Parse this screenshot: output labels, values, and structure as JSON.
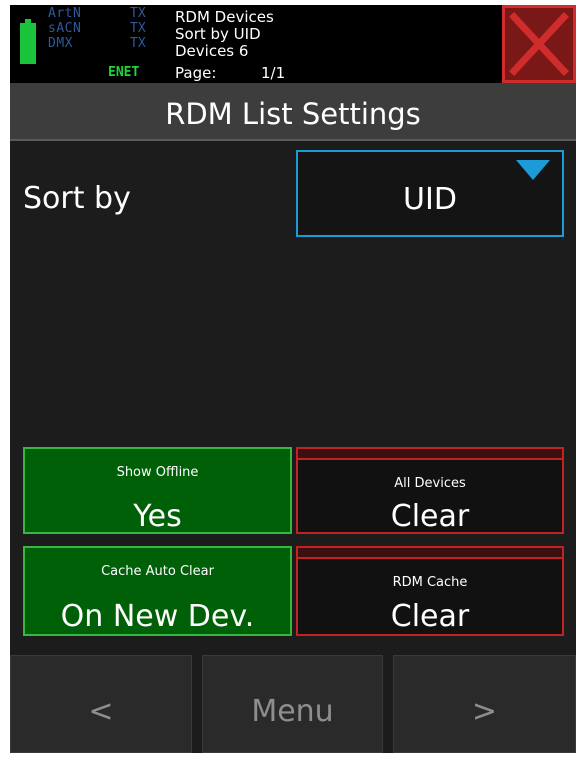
{
  "status": {
    "protocols": [
      {
        "name": "ArtN",
        "state": "TX"
      },
      {
        "name": "sACN",
        "state": "TX"
      },
      {
        "name": "DMX",
        "state": "TX"
      }
    ],
    "connection": "ENET",
    "info_title": "RDM Devices",
    "info_sort": "Sort by UID",
    "info_devices": "Devices 6",
    "page_label": "Page:",
    "page_value": "1/1"
  },
  "title": "RDM List Settings",
  "sort": {
    "label": "Sort by",
    "value": "UID"
  },
  "options": {
    "show_offline": {
      "label": "Show Offline",
      "value": "Yes"
    },
    "all_devices": {
      "label": "All Devices",
      "value": "Clear"
    },
    "cache_auto_clear": {
      "label": "Cache Auto Clear",
      "value": "On New Dev."
    },
    "rdm_cache": {
      "label": "RDM Cache",
      "value": "Clear"
    }
  },
  "nav": {
    "prev": "<",
    "menu": "Menu",
    "next": ">"
  },
  "colors": {
    "accent_blue": "#1d9bd8",
    "active_green": "#006008",
    "danger_red": "#c22222",
    "battery_green": "#19c33a"
  },
  "icons": {
    "battery": "battery-icon",
    "close": "close-icon",
    "dropdown": "triangle-down-icon"
  }
}
